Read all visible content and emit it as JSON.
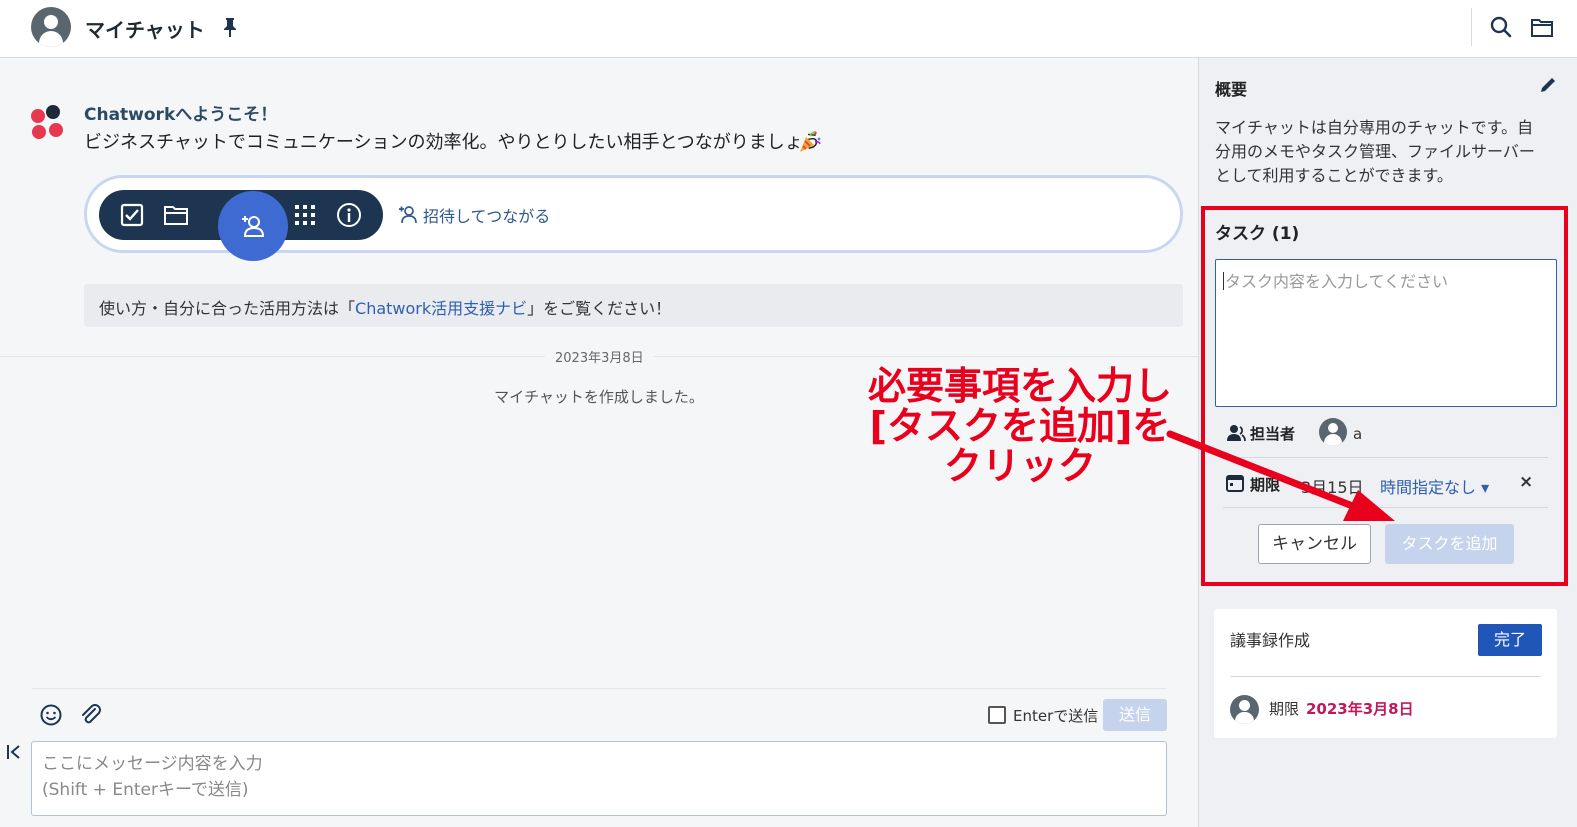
{
  "header": {
    "title": "マイチャット"
  },
  "welcome": {
    "title": "Chatworkへようこそ！",
    "text": "ビジネスチャットでコミュニケーションの効率化。やりとりしたい相手とつながりましょう"
  },
  "toolbar": {
    "invite_label": "招待してつながる"
  },
  "guide": {
    "prefix": "使い方・自分に合った活用方法は「",
    "link": "Chatwork活用支援ナビ",
    "suffix": "」をご覧ください！"
  },
  "timeline": {
    "date": "2023年3月8日",
    "system_message": "マイチャットを作成しました。"
  },
  "composer": {
    "enter_label": "Enterで送信",
    "send_label": "送信",
    "placeholder": "ここにメッセージ内容を入力\n(Shift + Enterキーで送信)"
  },
  "overview": {
    "title": "概要",
    "text": "マイチャットは自分専用のチャットです。自分用のメモやタスク管理、ファイルサーバーとして利用することができます。"
  },
  "task_form": {
    "title": "タスク (1)",
    "placeholder": "タスク内容を入力してください",
    "assignee_label": "担当者",
    "assignee_name": "a",
    "deadline_label": "期限",
    "deadline_date": "3月15日",
    "time_select": "時間指定なし ▾",
    "close": "×",
    "cancel_label": "キャンセル",
    "add_label": "タスクを追加"
  },
  "task_card": {
    "text": "議事録作成",
    "done_label": "完了",
    "deadline_label": "期限",
    "deadline_date": "2023年3月8日"
  },
  "annotation": {
    "text": "必要事項を入力し\n[タスクを追加]を\nクリック",
    "color": "#e8001c"
  },
  "colors": {
    "accent": "#1f56b8",
    "navy": "#1e3552",
    "highlight": "#e8001c",
    "date_red": "#c2185b"
  }
}
